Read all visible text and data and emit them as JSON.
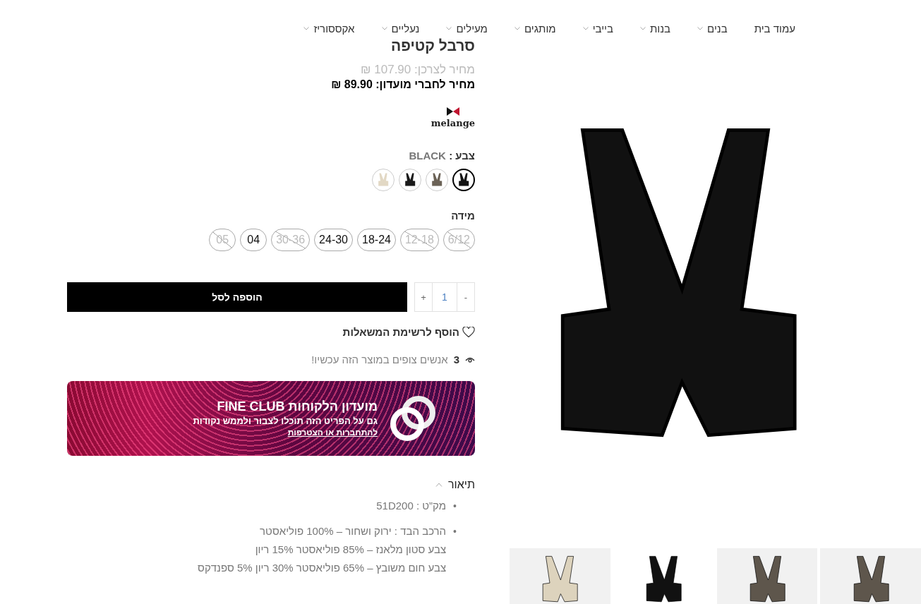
{
  "nav": [
    {
      "label": "עמוד בית",
      "has_menu": false
    },
    {
      "label": "בנים",
      "has_menu": true
    },
    {
      "label": "בנות",
      "has_menu": true
    },
    {
      "label": "בייבי",
      "has_menu": true
    },
    {
      "label": "מותגים",
      "has_menu": true
    },
    {
      "label": "מעילים",
      "has_menu": true
    },
    {
      "label": "נעליים",
      "has_menu": true
    },
    {
      "label": "אקססוריז",
      "has_menu": true
    }
  ],
  "product": {
    "title": "סרבל קטיפה",
    "retail_price": "מחיר לצרכן: 107.90 ₪",
    "club_price": "מחיר לחברי מועדון: 89.90 ₪",
    "brand": "melange",
    "color_label": "צבע :",
    "color_value": "BLACK",
    "swatches": [
      {
        "color": "#141414",
        "selected": true
      },
      {
        "color": "#6b6256",
        "selected": false
      },
      {
        "color": "#1a1a1a",
        "selected": false
      },
      {
        "color": "#e2d8c4",
        "selected": false
      }
    ],
    "size_label": "מידה",
    "sizes": [
      {
        "label": "6/12",
        "available": false
      },
      {
        "label": "12-18",
        "available": false
      },
      {
        "label": "18-24",
        "available": true
      },
      {
        "label": "24-30",
        "available": true
      },
      {
        "label": "30-36",
        "available": false
      },
      {
        "label": "04",
        "available": true
      },
      {
        "label": "05",
        "available": false
      }
    ],
    "quantity": {
      "minus": "-",
      "value": "1",
      "plus": "+"
    },
    "add_to_cart": "הוספה לסל",
    "wishlist": "הוסף לרשימת המשאלות",
    "viewers_count": "3",
    "viewers_text": "אנשים צופים במוצר הזה עכשיו!"
  },
  "club": {
    "title": "מועדון הלקוחות FINE CLUB",
    "subtitle": "גם על הפריט הזה תוכלו לצבור ולממש נקודות",
    "link": "להתחברות או הצטרפות"
  },
  "description": {
    "title": "תיאור",
    "expanded": true,
    "items": [
      {
        "bullet": "•",
        "lines": [
          "מק”ט : 51D200"
        ]
      },
      {
        "bullet": "•",
        "lines": [
          "הרכב הבד : ירוק ושחור – 100% פוליאסטר",
          "צבע סטון מלאנז – 85% פוליאסטר 15% ריון",
          "צבע חום משובץ – 65% פוליאסטר 30% ריון 5% ספנדקס"
        ]
      }
    ]
  },
  "thumbnails": [
    {
      "color": "#5e564c",
      "selected": false
    },
    {
      "color": "#5e564c",
      "selected": false
    },
    {
      "color": "#111111",
      "selected": true
    },
    {
      "color": "#ddd3bd",
      "selected": false
    }
  ]
}
